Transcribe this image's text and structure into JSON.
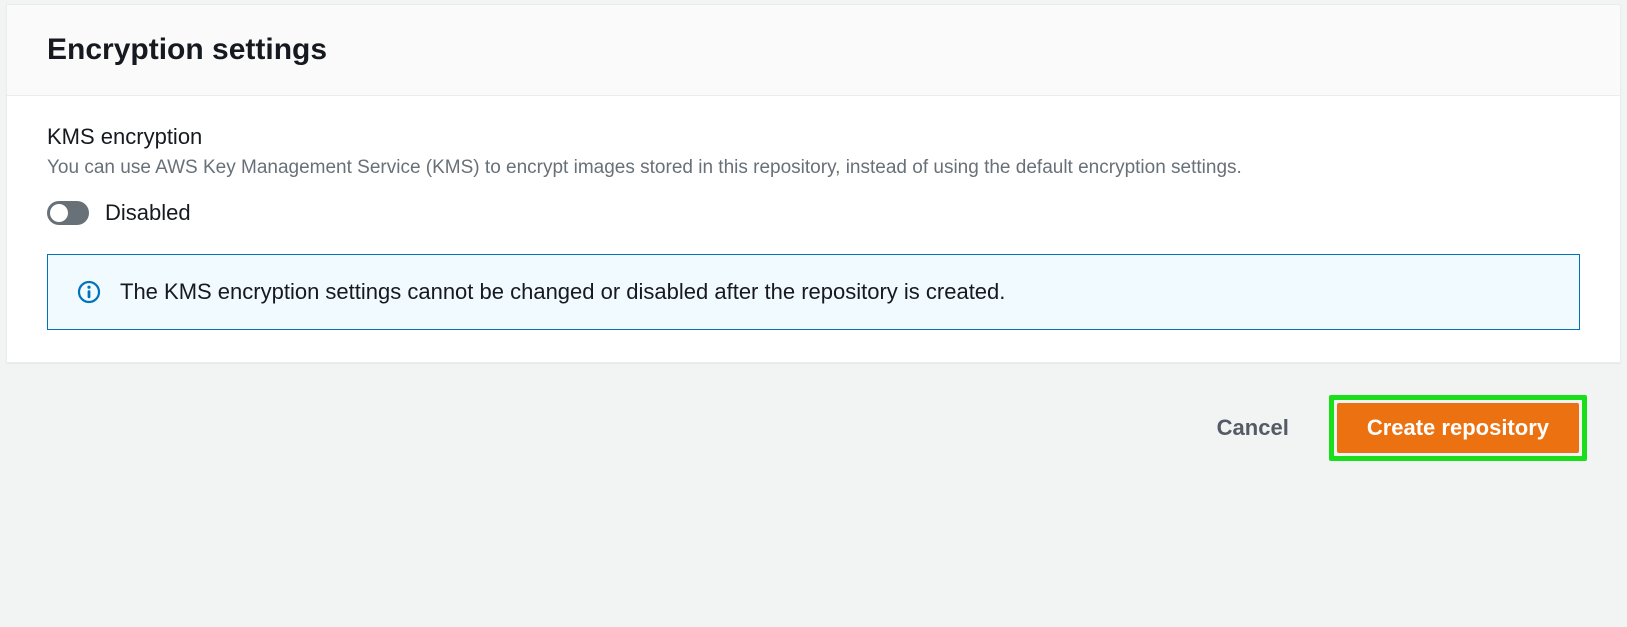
{
  "panel": {
    "title": "Encryption settings",
    "field": {
      "label": "KMS encryption",
      "description": "You can use AWS Key Management Service (KMS) to encrypt images stored in this repository, instead of using the default encryption settings.",
      "toggle_state_label": "Disabled"
    },
    "info_alert": "The KMS encryption settings cannot be changed or disabled after the repository is created."
  },
  "actions": {
    "cancel": "Cancel",
    "create": "Create repository"
  }
}
